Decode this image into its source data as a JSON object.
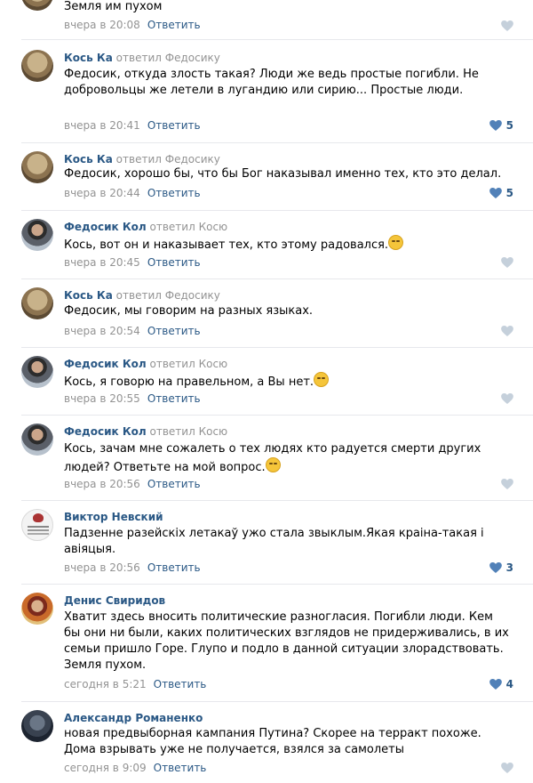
{
  "colors": {
    "link": "#2a5885",
    "muted": "#939393",
    "divider": "#e7e8ec",
    "like_active": "#5181b8",
    "like_inactive": "#c5d0db"
  },
  "replied_word": "ответил",
  "reply_label": "Ответить",
  "comments": [
    {
      "author": "",
      "reply_to": "",
      "text": "Земля им пухом",
      "date": "вчера в 20:08",
      "likes": "",
      "avatar": "cat-avatar"
    },
    {
      "author": "Кось Ка",
      "reply_to": "Федосику",
      "text": "Федосик, откуда злость такая? Люди же ведь простые погибли. Не добровольцы же летели в лугандию или сирию... Простые люди.",
      "date": "вчера в 20:41",
      "likes": "5",
      "avatar": "cat-avatar"
    },
    {
      "author": "Кось Ка",
      "reply_to": "Федосику",
      "text": "Федосик, хорошо бы, что бы Бог наказывал именно тех, кто это делал.",
      "date": "вчера в 20:44",
      "likes": "5",
      "avatar": "cat-avatar"
    },
    {
      "author": "Федосик Кол",
      "reply_to": "Косю",
      "text": "Кось, вот он и наказывает тех, кто этому радовался.",
      "date": "вчера в 20:45",
      "likes": "",
      "avatar": "user-photo-avatar",
      "emoji": "smirk-emoji"
    },
    {
      "author": "Кось Ка",
      "reply_to": "Федосику",
      "text": "Федосик, мы говорим на разных языках.",
      "date": "вчера в 20:54",
      "likes": "",
      "avatar": "cat-avatar"
    },
    {
      "author": "Федосик Кол",
      "reply_to": "Косю",
      "text": "Кось, я говорю на правельном, а Вы нет.",
      "date": "вчера в 20:55",
      "likes": "",
      "avatar": "user-photo-avatar",
      "emoji": "smirk-emoji"
    },
    {
      "author": "Федосик Кол",
      "reply_to": "Косю",
      "text": "Кось, зачам мне сожалеть о тех людях кто радуется смерти других людей? Ответьте на мой вопрос.",
      "date": "вчера в 20:56",
      "likes": "",
      "avatar": "user-photo-avatar",
      "emoji": "smirk-emoji"
    },
    {
      "author": "Виктор Невский",
      "reply_to": "",
      "text": "Падзенне разейскіх летакаў ужо стала звыклым.Якая краіна-такая і авіяцыя.",
      "date": "вчера в 20:56",
      "likes": "3",
      "avatar": "emblem-avatar"
    },
    {
      "author": "Денис Свиридов",
      "reply_to": "",
      "text": "Хватит здесь вносить политические разногласия. Погибли люди. Кем бы они ни были, каких политических взглядов не придерживались, в их семьи пришло Горе. Глупо и подло в данной ситуации злорадствовать. Земля пухом.",
      "date": "сегодня в 5:21",
      "likes": "4",
      "avatar": "user-photo-avatar"
    },
    {
      "author": "Александр Романенко",
      "reply_to": "",
      "text": "новая предвыборная кампания Путина? Скорее на терракт похоже. Дома взрывать уже не получается, взялся за самолеты",
      "date": "сегодня в 9:09",
      "likes": "",
      "avatar": "user-photo-avatar"
    }
  ]
}
